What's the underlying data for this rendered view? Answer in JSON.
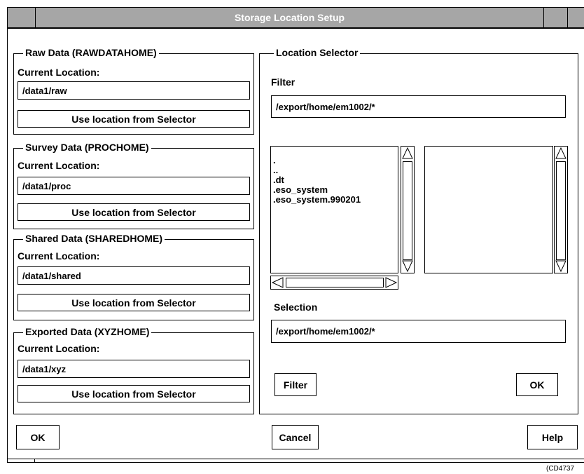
{
  "window": {
    "title": "Storage Location Setup"
  },
  "sections": [
    {
      "title": "Raw Data (RAWDATAHOME)",
      "current_location_label": "Current Location:",
      "location": "/data1/raw",
      "button_label": "Use location from Selector"
    },
    {
      "title": "Survey Data (PROCHOME)",
      "current_location_label": "Current Location:",
      "location": "/data1/proc",
      "button_label": "Use location from Selector"
    },
    {
      "title": "Shared Data (SHAREDHOME)",
      "current_location_label": "Current Location:",
      "location": "/data1/shared",
      "button_label": "Use location from Selector"
    },
    {
      "title": "Exported Data (XYZHOME)",
      "current_location_label": "Current Location:",
      "location": "/data1/xyz",
      "button_label": "Use location from Selector"
    }
  ],
  "selector": {
    "title": "Location Selector",
    "filter_label": "Filter",
    "filter_value": "/export/home/em1002/*",
    "directories": [
      ".",
      "..",
      ".dt",
      ".eso_system",
      ".eso_system.990201"
    ],
    "files": [],
    "selection_label": "Selection",
    "selection_value": "/export/home/em1002/*",
    "filter_button": "Filter",
    "ok_button": "OK"
  },
  "buttons": {
    "ok": "OK",
    "cancel": "Cancel",
    "help": "Help"
  },
  "credit": "(CD4737"
}
